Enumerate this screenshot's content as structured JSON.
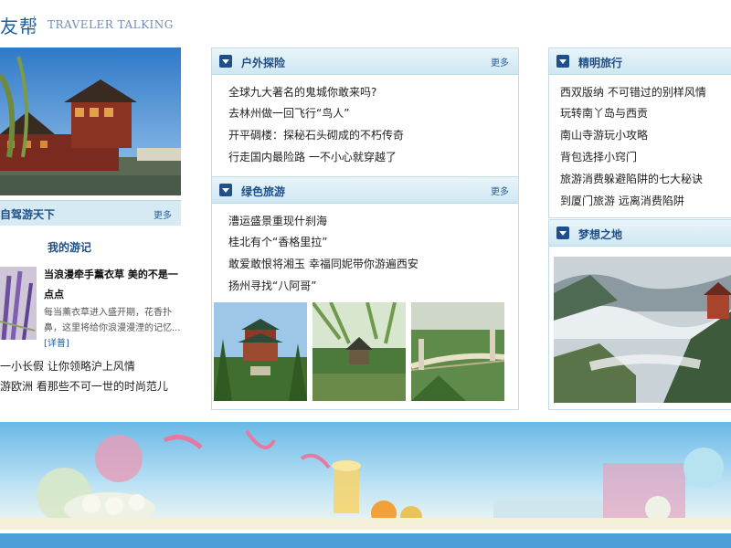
{
  "header": {
    "brand_cn": "友帮",
    "brand_en": "TRAVELER TALKING"
  },
  "left": {
    "bar_title": "自驾游天下",
    "bar_more": "更多",
    "notes_title": "我的游记",
    "featured_title": "当浪漫牵手薰衣草 美的不是一点点",
    "featured_desc": "每当薰衣草进入盛开期，花香扑鼻，这里将给你浪漫漫湮的记忆...",
    "featured_more": "[详普]",
    "links": [
      "一小长假 让你领略沪上风情",
      "游欧洲 看那些不可一世的时尚范儿"
    ]
  },
  "panels": {
    "outdoor": {
      "title": "户外探险",
      "more": "更多",
      "items": [
        "全球九大著名的鬼城你敢来吗?",
        "去林州做一回飞行“鸟人”",
        "开平碉楼：探秘石头砌成的不朽传奇",
        "行走国内最险路 一不小心就穿越了"
      ]
    },
    "green": {
      "title": "绿色旅游",
      "more": "更多",
      "items": [
        "漕运盛景重现什刹海",
        "桂北有个“香格里拉”",
        "敢爱敢恨将湘玉 幸福同妮带你游遍西安",
        "扬州寻找“八阿哥”"
      ]
    },
    "smart": {
      "title": "精明旅行",
      "items": [
        "西双版纳 不可错过的别样风情",
        "玩转南丫岛与西贡",
        "南山寺游玩小攻略",
        "背包选择小窍门",
        "旅游消费躲避陷阱的七大秘诀",
        "到厦门旅游 远离消费陷阱"
      ]
    },
    "dream": {
      "title": "梦想之地"
    }
  },
  "colors": {
    "accent": "#1f4f86",
    "panel_header": "#cfe7f2",
    "panel_border": "#c3dbe8",
    "bottom_strip": "#4d9fd8"
  }
}
